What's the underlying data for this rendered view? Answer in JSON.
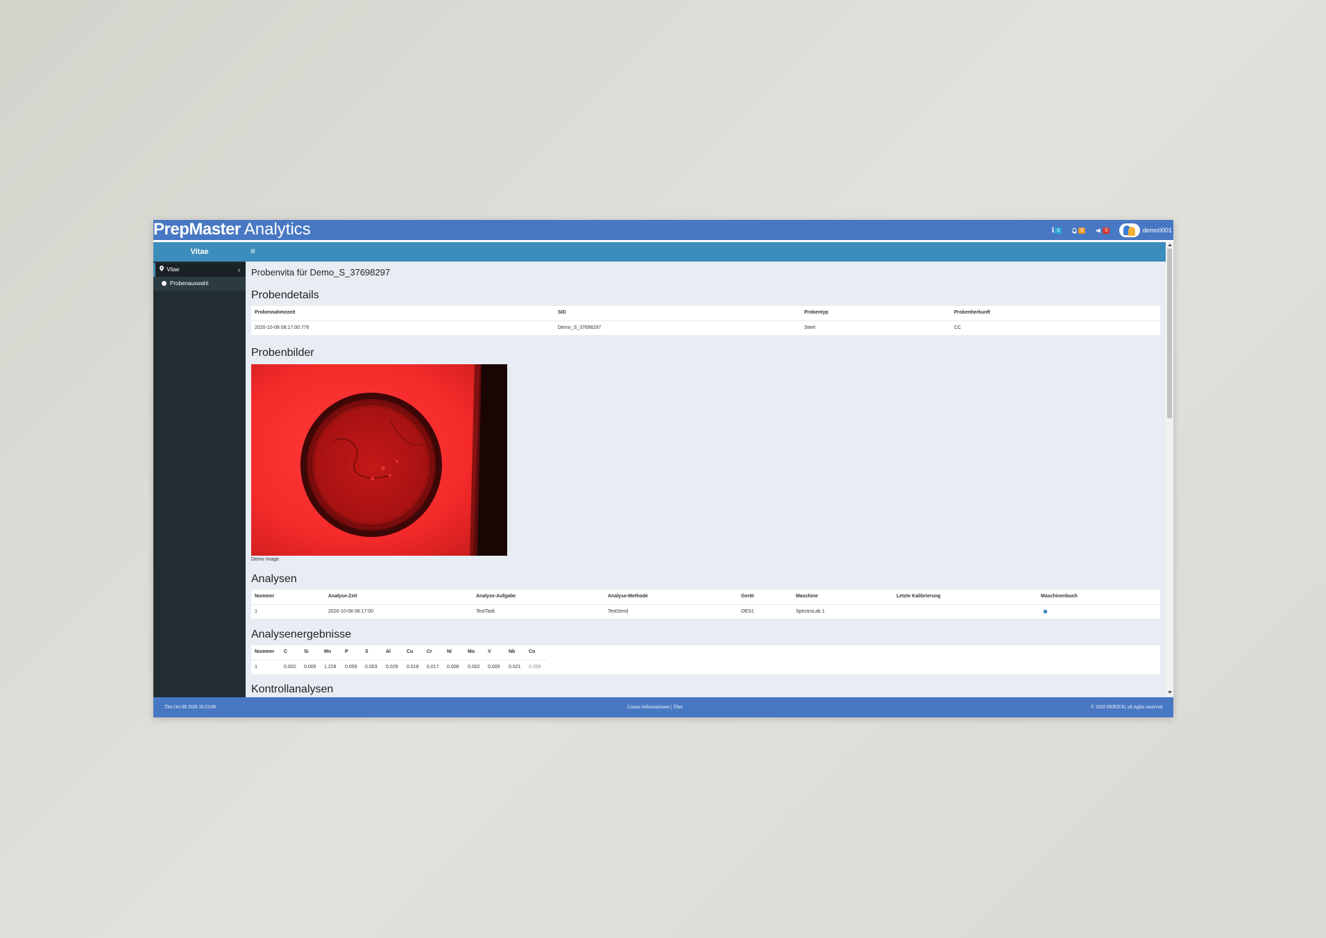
{
  "app": {
    "brand_bold": "PrepMaster",
    "brand_light": "Analytics"
  },
  "header": {
    "info_count": "0",
    "bell_count": "0",
    "flag_count": "0",
    "username": "demo0001"
  },
  "sidebar": {
    "title": "Vitae",
    "items": [
      {
        "label": "Vitae",
        "icon": "map-marker-icon"
      },
      {
        "label": "Probenauswahl",
        "icon": "circle-icon"
      }
    ]
  },
  "topbar": {
    "menu_icon": "≡"
  },
  "page": {
    "title": "Probenvita für Demo_S_37698297"
  },
  "details": {
    "heading": "Probendetails",
    "headers": [
      "Probennahmezeit",
      "SID",
      "Probentyp",
      "Probenherkunft"
    ],
    "row": [
      "2020-10-08 08:17:00.776",
      "Demo_S_37698297",
      "Steel",
      "CC"
    ]
  },
  "images": {
    "heading": "Probenbilder",
    "caption": "Demo Image"
  },
  "analyses": {
    "heading": "Analysen",
    "headers": [
      "Nummer",
      "Analyse-Zeit",
      "Analyse-Aufgabe",
      "Analyse-Methode",
      "Gerät",
      "Maschine",
      "Letzte Kalibrierung",
      "Maschinenbuch"
    ],
    "row": [
      "1",
      "2020-10-08 08:17:00",
      "TestTask",
      "TestSend",
      "OES1",
      "SpectroLab 1",
      "",
      ""
    ]
  },
  "results": {
    "heading": "Analysenergebnisse",
    "headers": [
      "Nummer",
      "C",
      "Si",
      "Mn",
      "P",
      "S",
      "Al",
      "Cu",
      "Cr",
      "Ni",
      "Mo",
      "V",
      "Nb",
      "Co"
    ],
    "row": [
      "1",
      "0.002",
      "0.005",
      "1.228",
      "0.059",
      "0.003",
      "0.029",
      "0.018",
      "0.017",
      "0.006",
      "0.002",
      "0.005",
      "0.021",
      "0.209"
    ]
  },
  "control": {
    "heading": "Kontrollanalysen"
  },
  "footer": {
    "datetime": "Thu Oct 08 2020 16:23:00",
    "links": "Lizenz-Informationen | Über",
    "copyright": "© 2020 HERZOG all rights reserved"
  },
  "colors": {
    "header": "#4878c3",
    "topbar": "#3c8dbc",
    "sidebar": "#222d32",
    "content_bg": "#e8edf4"
  }
}
